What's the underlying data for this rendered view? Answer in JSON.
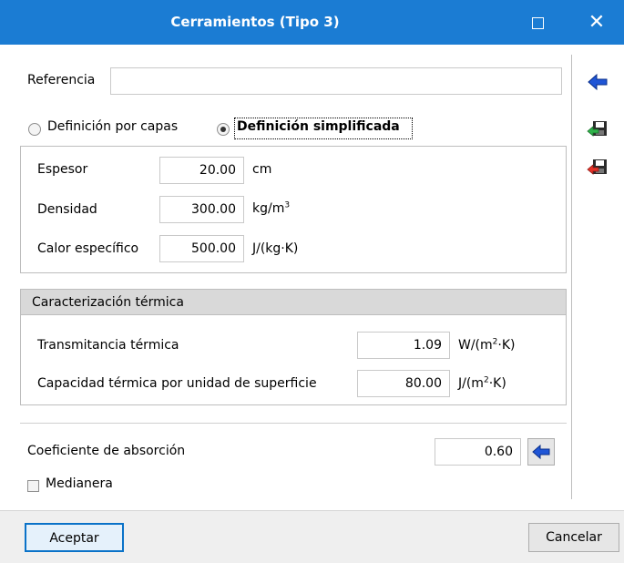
{
  "window": {
    "title": "Cerramientos (Tipo 3)",
    "maximize_icon": "maximize-icon",
    "close_glyph": "✕"
  },
  "reference": {
    "label": "Referencia",
    "value": ""
  },
  "mode": {
    "option_layers": "Definición por capas",
    "option_simplified": "Definición simplificada",
    "selected": "simplified"
  },
  "properties": [
    {
      "label": "Espesor",
      "value": "20.00",
      "unit": "cm"
    },
    {
      "label": "Densidad",
      "value": "300.00",
      "unit_base": "kg/m",
      "unit_sup": "3"
    },
    {
      "label": "Calor específico",
      "value": "500.00",
      "unit": "J/(kg·K)"
    }
  ],
  "thermal": {
    "header": "Caracterización térmica",
    "transmittance_label": "Transmitancia térmica",
    "transmittance_value": "1.09",
    "transmittance_unit_a": "W/(m",
    "transmittance_unit_sup": "2",
    "transmittance_unit_b": "·K)",
    "capacity_label": "Capacidad térmica por unidad de superficie",
    "capacity_value": "80.00",
    "capacity_unit_a": "J/(m",
    "capacity_unit_sup": "2",
    "capacity_unit_b": "·K)"
  },
  "absorption": {
    "label": "Coeficiente de absorción",
    "value": "0.60"
  },
  "medianera": {
    "label": "Medianera",
    "checked": false
  },
  "buttons": {
    "accept": "Aceptar",
    "cancel": "Cancelar"
  },
  "side_icons": [
    "arrow-left-icon",
    "save-to-library-icon",
    "load-from-library-icon"
  ],
  "colors": {
    "titlebar": "#1b7cd3",
    "accent": "#0a72c8"
  }
}
